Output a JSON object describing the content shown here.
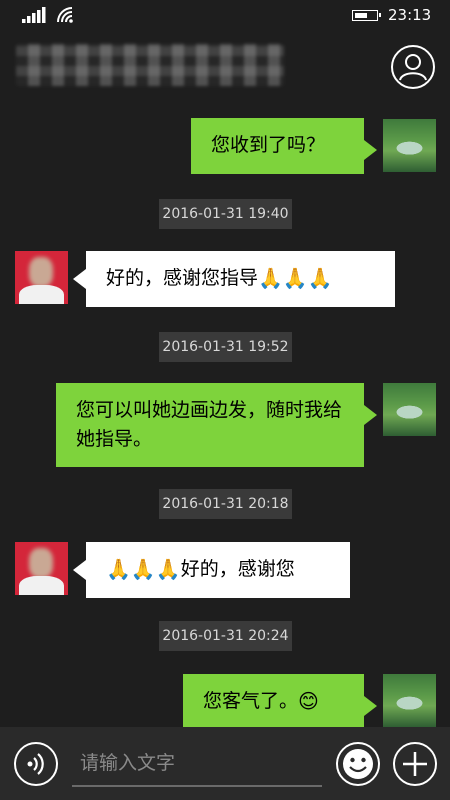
{
  "status_bar": {
    "time": "23:13",
    "battery_level": 0.65
  },
  "header": {
    "contact_name": "██████ ████",
    "profile_icon": "person-icon"
  },
  "messages": [
    {
      "sender": "me",
      "text": "您收到了吗？"
    },
    {
      "timestamp": "2016-01-31 19:40"
    },
    {
      "sender": "other",
      "text": "好的，感谢您指导",
      "emoji": "🙏🙏🙏"
    },
    {
      "timestamp": "2016-01-31 19:52"
    },
    {
      "sender": "me",
      "text": "您可以叫她边画边发，随时我给她指导。"
    },
    {
      "timestamp": "2016-01-31 20:18"
    },
    {
      "sender": "other",
      "emoji": "🙏🙏🙏",
      "text": "好的，感谢您"
    },
    {
      "timestamp": "2016-01-31 20:24"
    },
    {
      "sender": "me",
      "text": "您客气了。",
      "emoji": "😊"
    }
  ],
  "input_bar": {
    "placeholder": "请输入文字",
    "voice_icon": "voice-icon",
    "emoji_icon": "smiley-icon",
    "add_icon": "plus-icon"
  },
  "colors": {
    "outgoing_bubble": "#7ed33c",
    "incoming_bubble": "#ffffff",
    "background": "#1e1e1e",
    "timestamp_bg": "#3a3a3a"
  }
}
